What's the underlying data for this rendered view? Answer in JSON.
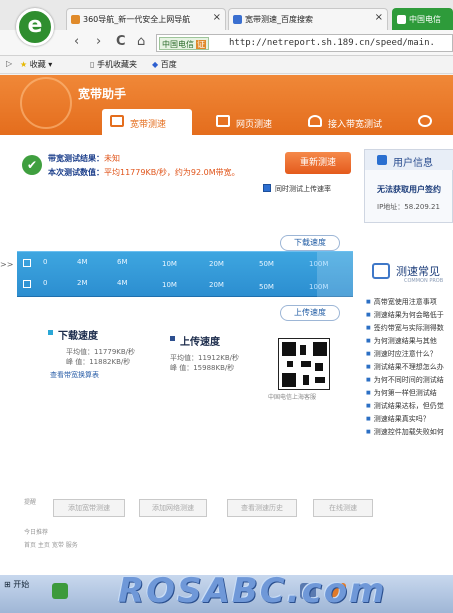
{
  "browser": {
    "logo_char": "e",
    "tabs": [
      {
        "label": "360导航_新一代安全上网导航",
        "close": "×",
        "color": "#e08a2a"
      },
      {
        "label": "宽带测速_百度搜索",
        "close": "×",
        "color": "#3a6fd0"
      },
      {
        "label": "中国电信",
        "close": "",
        "color": "#ffffff"
      }
    ],
    "nav": {
      "back": "‹",
      "forward": "›",
      "reload": "C",
      "home": "⌂"
    },
    "carrier": "中国电信",
    "cert": "证",
    "url": "http://netreport.sh.189.cn/speed/main.",
    "favorites": [
      {
        "label": "收藏",
        "icon": "star-icon"
      },
      {
        "label": "手机收藏夹",
        "icon": "phone-icon"
      },
      {
        "label": "百度",
        "icon": "baidu-icon"
      }
    ]
  },
  "app": {
    "title": "宽带助手",
    "tabs": [
      {
        "label": "宽带测速",
        "active": true
      },
      {
        "label": "网页测速",
        "active": false
      },
      {
        "label": "接入带宽测试",
        "active": false
      }
    ]
  },
  "result": {
    "check": "✔",
    "line1_label": "带宽测试结果：",
    "line1_value": "未知",
    "line2_label": "本次测试数值：",
    "line2_value": "平均11779KB/秒，约为92.0M带宽。",
    "retest_label": "重新测速",
    "upload_checkbox_label": "同时测试上传速率",
    "upload_checked": true
  },
  "user_info": {
    "title": "用户信息",
    "note": "无法获取用户签约",
    "ip_label": "IP地址：58.209.21"
  },
  "speedbar": {
    "download_bubble": "下载速度",
    "upload_bubble": "上传速度",
    "row1_ticks": [
      "0",
      "4M",
      "6M",
      "10M",
      "20M",
      "50M",
      "100M"
    ],
    "row2_ticks": [
      "0",
      "2M",
      "4M",
      "10M",
      "20M",
      "50M",
      "100M"
    ]
  },
  "summary": {
    "download_title": "下载速度",
    "download_avg": "平均值：11779KB/秒",
    "download_peak": "峰  值：11882KB/秒",
    "download_link": "查看带宽换算表",
    "upload_title": "上传速度",
    "upload_avg": "平均值：11912KB/秒",
    "upload_peak": "峰  值：15988KB/秒",
    "qr_caption": "中国电信上海客服"
  },
  "tips": {
    "title": "测速常见",
    "subtitle": "COMMON PROB",
    "items": [
      "高带宽使用注意事项",
      "测速结果为何会略低于",
      "签约带宽与实际测得数",
      "为何测速结果与其他",
      "测速时应注意什么？",
      "测试结果不理想怎么办",
      "为何不同时间的测试结",
      "为何第一样但测试结",
      "测试结果达标，但仍觉",
      "测速结果真实吗？",
      "测速控件加载失败如何"
    ]
  },
  "bottom": {
    "buttons": [
      "添加宽带测速",
      "添加网络测速",
      "查看测速历史",
      "在线测速"
    ],
    "side_caption_1": "提醒",
    "side_caption_2": "今日推荐",
    "side_caption_3": "首页 主页   宽带 服务"
  },
  "taskbar": {
    "start_label": "开始"
  },
  "watermark": "ROSABC.com",
  "left_marker": ">>"
}
